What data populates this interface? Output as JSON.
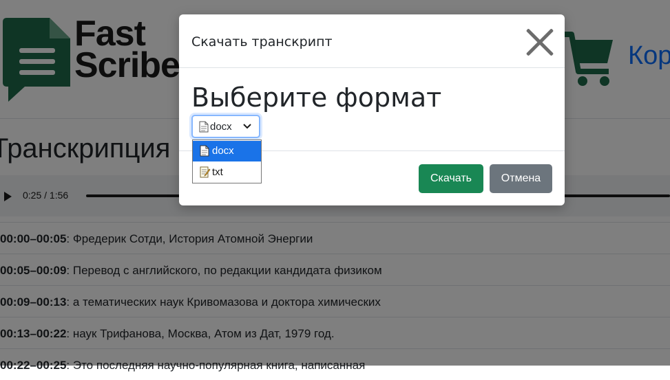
{
  "brand": {
    "line1": "Fast",
    "line2": "Scribe",
    "color": "#1e6b4a"
  },
  "header": {
    "cart_label": "Кор"
  },
  "section": {
    "title": "Транскрипция"
  },
  "player": {
    "time": "0:25 / 1:56"
  },
  "transcript": [
    {
      "stamp": "00:00–00:05",
      "text": ": Фредерик Сотди, История Атомной Энергии"
    },
    {
      "stamp": "00:05–00:09",
      "text": ": Перевод с английского, по редакции кандидата физиком"
    },
    {
      "stamp": "00:09–00:13",
      "text": ": а тематических наук Кривомазова и доктора химических"
    },
    {
      "stamp": "00:13–00:22",
      "text": ": наук Трифанова, Москва, Атом из Дат, 1979 год."
    },
    {
      "stamp": "00:22–00:25",
      "text": ": Это последняя научно-популярная книга, написанная"
    }
  ],
  "modal": {
    "title": "Скачать транскрипт",
    "heading": "Выберите формат",
    "select_value": "docx",
    "options": [
      "docx",
      "txt"
    ],
    "download_label": "Скачать",
    "cancel_label": "Отмена"
  },
  "colors": {
    "primary": "#198754",
    "secondary": "#6c757d",
    "link": "#0d6efd",
    "highlight": "#1a73e8"
  }
}
